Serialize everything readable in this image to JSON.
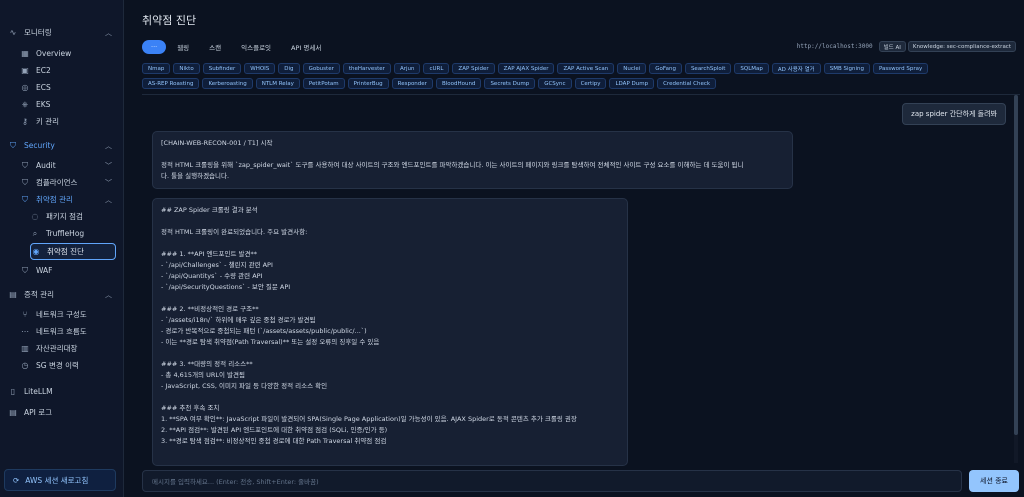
{
  "sidebar": {
    "monitoring": "모니터링",
    "overview": "Overview",
    "ec2": "EC2",
    "ecs": "ECS",
    "eks": "EKS",
    "keys": "키 관리",
    "security": "Security",
    "audit": "Audit",
    "compliance": "컴플라이언스",
    "vuln_mgmt": "취약점 관리",
    "package_check": "패키지 점검",
    "trufflehog": "TruffleHog",
    "vuln_diag": "취약점 진단",
    "waf": "WAF",
    "asset_mgmt": "증적 관리",
    "network_config": "네트워크 구성도",
    "network_flow": "네트워크 흐름도",
    "asset_ledger": "자산관리대장",
    "sg_history": "SG 변경 이력",
    "litellm": "LiteLLM",
    "api_log": "API 로그",
    "aws_refresh": "AWS 세션 새로고침"
  },
  "main": {
    "title": "취약점 진단",
    "tabs": [
      "···",
      "웹링",
      "스캔",
      "익스플로잇",
      "API 명세서"
    ],
    "url": "http://localhost:3000",
    "badge1": "빌드 AI",
    "badge2": "Knowledge: sec-compliance-extract",
    "tools_row1": [
      "Nmap",
      "Nikto",
      "Subfinder",
      "WHOIS",
      "Dig",
      "Gobuster",
      "theHarvester",
      "Arjun",
      "cURL",
      "ZAP Spider",
      "ZAP AJAX Spider",
      "ZAP Active Scan",
      "Nuclei",
      "GoFang",
      "SearchSploit",
      "SQLMap",
      "AD 사용자 열거",
      "SMB Signing",
      "Password Spray"
    ],
    "tools_row2": [
      "AS-REP Roasting",
      "Kerberoasting",
      "NTLM Relay",
      "PetitPotam",
      "PrinterBug",
      "Responder",
      "BloodHound",
      "Secrets Dump",
      "GCSync",
      "Certipy",
      "LDAP Dump",
      "Credential Check"
    ]
  },
  "chat": {
    "user_message": "zap spider 간단하게 돌려봐",
    "msg1_lines": [
      "[CHAIN-WEB-RECON-001 / T1] 시작",
      "",
      "정적 HTML 크롤링을 위해 `zap_spider_wait` 도구를 사용하여 대상 사이트의 구조와 엔드포인트를 파악하겠습니다. 이는 사이트의 페이지와 링크를 탐색하여 전체적인 사이트 구성 요소를 이해하는 데 도움이 됩니",
      "다. 툴을 실행하겠습니다."
    ],
    "msg2_lines": [
      "## ZAP Spider 크롤링 결과 분석",
      "",
      "정적 HTML 크롤링이 완료되었습니다. 주요 발견사항:",
      "",
      "### 1. **API 엔드포인트 발견**",
      "- `/api/Challenges` - 챌린지 관련 API",
      "- `/api/Quantitys` - 수량 관련 API",
      "- `/api/SecurityQuestions` - 보안 질문 API",
      "",
      "### 2. **비정상적인 경로 구조**",
      "- `/assets/i18n/` 하위에 매우 깊은 중첩 경로가 발견됨",
      "- 경로가 반복적으로 중첩되는 패턴 (`/assets/assets/public/public/...`)",
      "- 이는 **경로 탐색 취약점(Path Traversal)** 또는 설정 오류의 징후일 수 있음",
      "",
      "### 3. **대량의 정적 리소스**",
      "- 총 4,615개의 URL이 발견됨",
      "- JavaScript, CSS, 이미지 파일 등 다양한 정적 리소스 확인",
      "",
      "### 추천 후속 조치",
      "1. **SPA 여부 확인**: JavaScript 파일이 발견되어 SPA(Single Page Application)일 가능성이 있음. AJAX Spider로 동적 콘텐츠 추가 크롤링 권장",
      "2. **API 점검**: 발견된 API 엔드포인트에 대한 취약점 점검 (SQLi, 인증/인가 등)",
      "3. **경로 탐색 점검**: 비정상적인 중첩 경로에 대한 Path Traversal 취약점 점검"
    ],
    "input_placeholder": "메시지를 입력하세요... (Enter: 전송, Shift+Enter: 줄바꿈)",
    "end_button": "세션 종료"
  },
  "colors": {
    "accent": "#3b82f6",
    "active_link": "#60a5fa",
    "background": "#0b1220"
  }
}
